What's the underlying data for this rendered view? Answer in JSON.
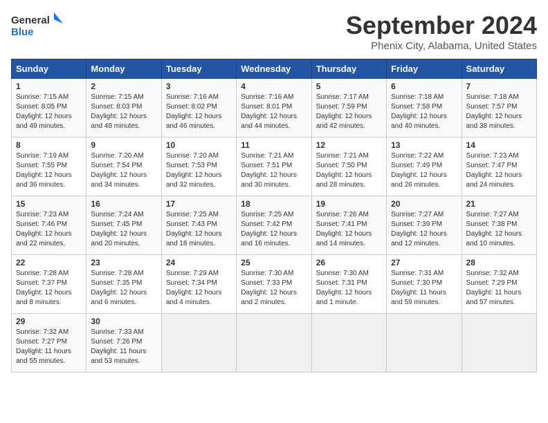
{
  "header": {
    "logo_general": "General",
    "logo_blue": "Blue",
    "month_year": "September 2024",
    "location": "Phenix City, Alabama, United States"
  },
  "weekdays": [
    "Sunday",
    "Monday",
    "Tuesday",
    "Wednesday",
    "Thursday",
    "Friday",
    "Saturday"
  ],
  "weeks": [
    [
      {
        "day": "1",
        "sunrise": "7:15 AM",
        "sunset": "8:05 PM",
        "daylight": "12 hours and 49 minutes."
      },
      {
        "day": "2",
        "sunrise": "7:15 AM",
        "sunset": "8:03 PM",
        "daylight": "12 hours and 48 minutes."
      },
      {
        "day": "3",
        "sunrise": "7:16 AM",
        "sunset": "8:02 PM",
        "daylight": "12 hours and 46 minutes."
      },
      {
        "day": "4",
        "sunrise": "7:16 AM",
        "sunset": "8:01 PM",
        "daylight": "12 hours and 44 minutes."
      },
      {
        "day": "5",
        "sunrise": "7:17 AM",
        "sunset": "7:59 PM",
        "daylight": "12 hours and 42 minutes."
      },
      {
        "day": "6",
        "sunrise": "7:18 AM",
        "sunset": "7:58 PM",
        "daylight": "12 hours and 40 minutes."
      },
      {
        "day": "7",
        "sunrise": "7:18 AM",
        "sunset": "7:57 PM",
        "daylight": "12 hours and 38 minutes."
      }
    ],
    [
      {
        "day": "8",
        "sunrise": "7:19 AM",
        "sunset": "7:55 PM",
        "daylight": "12 hours and 36 minutes."
      },
      {
        "day": "9",
        "sunrise": "7:20 AM",
        "sunset": "7:54 PM",
        "daylight": "12 hours and 34 minutes."
      },
      {
        "day": "10",
        "sunrise": "7:20 AM",
        "sunset": "7:53 PM",
        "daylight": "12 hours and 32 minutes."
      },
      {
        "day": "11",
        "sunrise": "7:21 AM",
        "sunset": "7:51 PM",
        "daylight": "12 hours and 30 minutes."
      },
      {
        "day": "12",
        "sunrise": "7:21 AM",
        "sunset": "7:50 PM",
        "daylight": "12 hours and 28 minutes."
      },
      {
        "day": "13",
        "sunrise": "7:22 AM",
        "sunset": "7:49 PM",
        "daylight": "12 hours and 26 minutes."
      },
      {
        "day": "14",
        "sunrise": "7:23 AM",
        "sunset": "7:47 PM",
        "daylight": "12 hours and 24 minutes."
      }
    ],
    [
      {
        "day": "15",
        "sunrise": "7:23 AM",
        "sunset": "7:46 PM",
        "daylight": "12 hours and 22 minutes."
      },
      {
        "day": "16",
        "sunrise": "7:24 AM",
        "sunset": "7:45 PM",
        "daylight": "12 hours and 20 minutes."
      },
      {
        "day": "17",
        "sunrise": "7:25 AM",
        "sunset": "7:43 PM",
        "daylight": "12 hours and 18 minutes."
      },
      {
        "day": "18",
        "sunrise": "7:25 AM",
        "sunset": "7:42 PM",
        "daylight": "12 hours and 16 minutes."
      },
      {
        "day": "19",
        "sunrise": "7:26 AM",
        "sunset": "7:41 PM",
        "daylight": "12 hours and 14 minutes."
      },
      {
        "day": "20",
        "sunrise": "7:27 AM",
        "sunset": "7:39 PM",
        "daylight": "12 hours and 12 minutes."
      },
      {
        "day": "21",
        "sunrise": "7:27 AM",
        "sunset": "7:38 PM",
        "daylight": "12 hours and 10 minutes."
      }
    ],
    [
      {
        "day": "22",
        "sunrise": "7:28 AM",
        "sunset": "7:37 PM",
        "daylight": "12 hours and 8 minutes."
      },
      {
        "day": "23",
        "sunrise": "7:28 AM",
        "sunset": "7:35 PM",
        "daylight": "12 hours and 6 minutes."
      },
      {
        "day": "24",
        "sunrise": "7:29 AM",
        "sunset": "7:34 PM",
        "daylight": "12 hours and 4 minutes."
      },
      {
        "day": "25",
        "sunrise": "7:30 AM",
        "sunset": "7:33 PM",
        "daylight": "12 hours and 2 minutes."
      },
      {
        "day": "26",
        "sunrise": "7:30 AM",
        "sunset": "7:31 PM",
        "daylight": "12 hours and 1 minute."
      },
      {
        "day": "27",
        "sunrise": "7:31 AM",
        "sunset": "7:30 PM",
        "daylight": "11 hours and 59 minutes."
      },
      {
        "day": "28",
        "sunrise": "7:32 AM",
        "sunset": "7:29 PM",
        "daylight": "11 hours and 57 minutes."
      }
    ],
    [
      {
        "day": "29",
        "sunrise": "7:32 AM",
        "sunset": "7:27 PM",
        "daylight": "11 hours and 55 minutes."
      },
      {
        "day": "30",
        "sunrise": "7:33 AM",
        "sunset": "7:26 PM",
        "daylight": "11 hours and 53 minutes."
      },
      null,
      null,
      null,
      null,
      null
    ]
  ]
}
